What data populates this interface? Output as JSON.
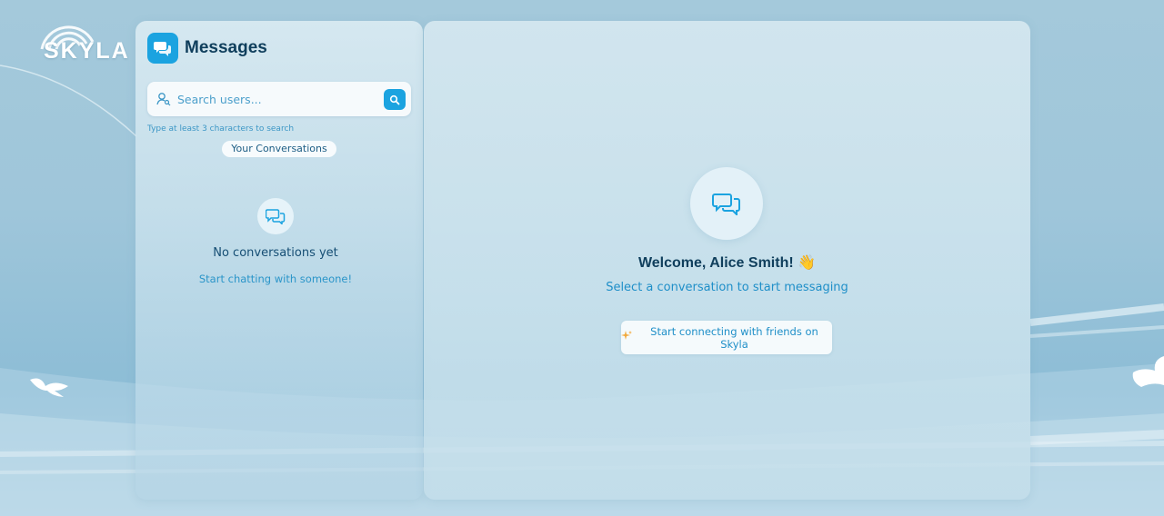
{
  "brand": {
    "logo_text": "SKYLA"
  },
  "sidebar": {
    "title": "Messages",
    "search": {
      "placeholder": "Search users...",
      "hint": "Type at least 3 characters to search"
    },
    "conversations_tab_label": "Your Conversations",
    "empty_state": {
      "title": "No conversations yet",
      "subtitle": "Start chatting with someone!"
    }
  },
  "main": {
    "welcome_title": "Welcome, Alice Smith! 👋",
    "welcome_subtitle": "Select a conversation to start messaging",
    "connect_button_label": "Start connecting with friends on Skyla"
  },
  "icons": {
    "header": "chat-bubbles-icon",
    "search_user": "user-search-icon",
    "search_button": "magnifier-icon",
    "empty_state": "chat-bubbles-icon",
    "welcome": "chat-bubbles-icon",
    "connect_button": "sparkle-icon"
  },
  "colors": {
    "accent": "#1ba3e0",
    "heading": "#0f3e5c",
    "link_text": "#1f8fc8",
    "background": "#a4c9db"
  }
}
